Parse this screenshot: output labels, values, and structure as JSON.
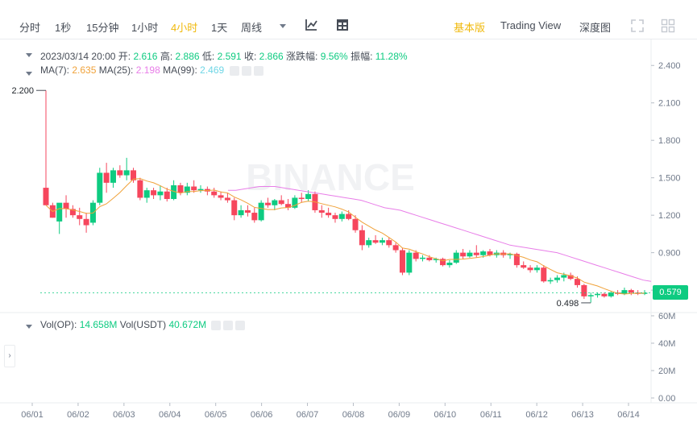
{
  "toolbar": {
    "timeframes": [
      "分时",
      "1秒",
      "15分钟",
      "1小时",
      "4小时",
      "1天",
      "周线"
    ],
    "active_timeframe": "4小时",
    "views": [
      "基本版",
      "Trading View",
      "深度图"
    ],
    "active_view": "基本版"
  },
  "candle_info": {
    "date": "2023/03/14 20:00",
    "open_label": "开:",
    "open": "2.616",
    "high_label": "高:",
    "high": "2.886",
    "low_label": "低:",
    "low": "2.591",
    "close_label": "收:",
    "close": "2.866",
    "change_label": "涨跌幅:",
    "change": "9.56%",
    "amplitude_label": "振幅:",
    "amplitude": "11.28%"
  },
  "ma_info": {
    "ma7_label": "MA(7):",
    "ma7": "2.635",
    "ma25_label": "MA(25):",
    "ma25": "2.198",
    "ma99_label": "MA(99):",
    "ma99": "2.469"
  },
  "vol_info": {
    "vol_op_label": "Vol(OP):",
    "vol_op": "14.658M",
    "vol_usdt_label": "Vol(USDT)",
    "vol_usdt": "40.672M"
  },
  "watermark": "BINANCE",
  "current_price": "0.579",
  "colors": {
    "up": "#0ecb81",
    "down": "#f6465d",
    "ma7": "#f0a23a",
    "ma25": "#e87de8",
    "accent": "#f0b90b"
  },
  "chart_data": {
    "type": "candlestick",
    "x_tick_labels": [
      "06/01",
      "06/02",
      "06/03",
      "06/04",
      "06/05",
      "06/06",
      "06/07",
      "06/08",
      "06/09",
      "06/10",
      "06/11",
      "06/12",
      "06/13",
      "06/14"
    ],
    "price_axis": {
      "ticks": [
        "2.400",
        "2.100",
        "1.800",
        "1.500",
        "1.200",
        "0.900",
        "0.600"
      ],
      "ylim": [
        0.42,
        2.55
      ]
    },
    "volume_axis": {
      "ticks": [
        "60M",
        "40M",
        "20M",
        "0.00"
      ],
      "ylim": [
        0,
        60
      ]
    },
    "annotations": {
      "high": "2.200",
      "low": "0.498"
    },
    "candles": [
      {
        "o": 1.42,
        "h": 2.2,
        "l": 1.36,
        "c": 1.28
      },
      {
        "o": 1.28,
        "h": 1.3,
        "l": 1.18,
        "c": 1.18
      },
      {
        "o": 1.15,
        "h": 1.28,
        "l": 1.05,
        "c": 1.3
      },
      {
        "o": 1.3,
        "h": 1.36,
        "l": 1.18,
        "c": 1.25
      },
      {
        "o": 1.25,
        "h": 1.28,
        "l": 1.18,
        "c": 1.2
      },
      {
        "o": 1.2,
        "h": 1.26,
        "l": 1.12,
        "c": 1.17
      },
      {
        "o": 1.17,
        "h": 1.22,
        "l": 1.06,
        "c": 1.12
      },
      {
        "o": 1.14,
        "h": 1.32,
        "l": 1.12,
        "c": 1.3
      },
      {
        "o": 1.3,
        "h": 1.58,
        "l": 1.28,
        "c": 1.54
      },
      {
        "o": 1.54,
        "h": 1.62,
        "l": 1.38,
        "c": 1.46
      },
      {
        "o": 1.46,
        "h": 1.58,
        "l": 1.42,
        "c": 1.56
      },
      {
        "o": 1.56,
        "h": 1.6,
        "l": 1.5,
        "c": 1.52
      },
      {
        "o": 1.52,
        "h": 1.66,
        "l": 1.48,
        "c": 1.56
      },
      {
        "o": 1.56,
        "h": 1.58,
        "l": 1.46,
        "c": 1.48
      },
      {
        "o": 1.48,
        "h": 1.5,
        "l": 1.32,
        "c": 1.34
      },
      {
        "o": 1.34,
        "h": 1.42,
        "l": 1.3,
        "c": 1.4
      },
      {
        "o": 1.4,
        "h": 1.42,
        "l": 1.33,
        "c": 1.36
      },
      {
        "o": 1.36,
        "h": 1.44,
        "l": 1.32,
        "c": 1.39
      },
      {
        "o": 1.39,
        "h": 1.42,
        "l": 1.31,
        "c": 1.33
      },
      {
        "o": 1.33,
        "h": 1.48,
        "l": 1.32,
        "c": 1.44
      },
      {
        "o": 1.44,
        "h": 1.46,
        "l": 1.36,
        "c": 1.38
      },
      {
        "o": 1.38,
        "h": 1.46,
        "l": 1.36,
        "c": 1.43
      },
      {
        "o": 1.43,
        "h": 1.48,
        "l": 1.38,
        "c": 1.4
      },
      {
        "o": 1.4,
        "h": 1.44,
        "l": 1.38,
        "c": 1.41
      },
      {
        "o": 1.41,
        "h": 1.43,
        "l": 1.36,
        "c": 1.39
      },
      {
        "o": 1.39,
        "h": 1.42,
        "l": 1.34,
        "c": 1.36
      },
      {
        "o": 1.36,
        "h": 1.39,
        "l": 1.32,
        "c": 1.34
      },
      {
        "o": 1.34,
        "h": 1.38,
        "l": 1.3,
        "c": 1.32
      },
      {
        "o": 1.32,
        "h": 1.34,
        "l": 1.16,
        "c": 1.2
      },
      {
        "o": 1.2,
        "h": 1.28,
        "l": 1.18,
        "c": 1.24
      },
      {
        "o": 1.24,
        "h": 1.28,
        "l": 1.19,
        "c": 1.22
      },
      {
        "o": 1.22,
        "h": 1.26,
        "l": 1.14,
        "c": 1.16
      },
      {
        "o": 1.16,
        "h": 1.32,
        "l": 1.15,
        "c": 1.3
      },
      {
        "o": 1.3,
        "h": 1.34,
        "l": 1.26,
        "c": 1.28
      },
      {
        "o": 1.28,
        "h": 1.33,
        "l": 1.24,
        "c": 1.32
      },
      {
        "o": 1.32,
        "h": 1.36,
        "l": 1.28,
        "c": 1.29
      },
      {
        "o": 1.29,
        "h": 1.33,
        "l": 1.24,
        "c": 1.26
      },
      {
        "o": 1.26,
        "h": 1.36,
        "l": 1.25,
        "c": 1.34
      },
      {
        "o": 1.34,
        "h": 1.38,
        "l": 1.3,
        "c": 1.33
      },
      {
        "o": 1.33,
        "h": 1.4,
        "l": 1.31,
        "c": 1.37
      },
      {
        "o": 1.37,
        "h": 1.39,
        "l": 1.22,
        "c": 1.24
      },
      {
        "o": 1.24,
        "h": 1.28,
        "l": 1.18,
        "c": 1.22
      },
      {
        "o": 1.22,
        "h": 1.26,
        "l": 1.18,
        "c": 1.2
      },
      {
        "o": 1.2,
        "h": 1.22,
        "l": 1.14,
        "c": 1.17
      },
      {
        "o": 1.17,
        "h": 1.23,
        "l": 1.15,
        "c": 1.21
      },
      {
        "o": 1.21,
        "h": 1.24,
        "l": 1.16,
        "c": 1.17
      },
      {
        "o": 1.17,
        "h": 1.2,
        "l": 1.06,
        "c": 1.08
      },
      {
        "o": 1.08,
        "h": 1.12,
        "l": 0.92,
        "c": 0.96
      },
      {
        "o": 0.96,
        "h": 1.02,
        "l": 0.94,
        "c": 1.0
      },
      {
        "o": 1.0,
        "h": 1.04,
        "l": 0.97,
        "c": 0.98
      },
      {
        "o": 0.98,
        "h": 1.02,
        "l": 0.96,
        "c": 1.0
      },
      {
        "o": 1.0,
        "h": 1.02,
        "l": 0.94,
        "c": 0.96
      },
      {
        "o": 0.96,
        "h": 0.98,
        "l": 0.9,
        "c": 0.92
      },
      {
        "o": 0.92,
        "h": 0.94,
        "l": 0.72,
        "c": 0.74
      },
      {
        "o": 0.74,
        "h": 0.92,
        "l": 0.72,
        "c": 0.9
      },
      {
        "o": 0.9,
        "h": 0.92,
        "l": 0.83,
        "c": 0.85
      },
      {
        "o": 0.85,
        "h": 0.88,
        "l": 0.83,
        "c": 0.86
      },
      {
        "o": 0.86,
        "h": 0.88,
        "l": 0.83,
        "c": 0.84
      },
      {
        "o": 0.84,
        "h": 0.86,
        "l": 0.82,
        "c": 0.85
      },
      {
        "o": 0.85,
        "h": 0.86,
        "l": 0.79,
        "c": 0.8
      },
      {
        "o": 0.8,
        "h": 0.84,
        "l": 0.78,
        "c": 0.82
      },
      {
        "o": 0.82,
        "h": 0.92,
        "l": 0.81,
        "c": 0.9
      },
      {
        "o": 0.9,
        "h": 0.93,
        "l": 0.85,
        "c": 0.87
      },
      {
        "o": 0.87,
        "h": 0.92,
        "l": 0.86,
        "c": 0.9
      },
      {
        "o": 0.9,
        "h": 0.96,
        "l": 0.86,
        "c": 0.88
      },
      {
        "o": 0.88,
        "h": 0.92,
        "l": 0.86,
        "c": 0.91
      },
      {
        "o": 0.91,
        "h": 0.93,
        "l": 0.87,
        "c": 0.88
      },
      {
        "o": 0.88,
        "h": 0.92,
        "l": 0.86,
        "c": 0.9
      },
      {
        "o": 0.9,
        "h": 0.92,
        "l": 0.86,
        "c": 0.88
      },
      {
        "o": 0.88,
        "h": 0.9,
        "l": 0.85,
        "c": 0.89
      },
      {
        "o": 0.89,
        "h": 0.9,
        "l": 0.78,
        "c": 0.8
      },
      {
        "o": 0.8,
        "h": 0.83,
        "l": 0.77,
        "c": 0.78
      },
      {
        "o": 0.78,
        "h": 0.8,
        "l": 0.74,
        "c": 0.76
      },
      {
        "o": 0.76,
        "h": 0.8,
        "l": 0.74,
        "c": 0.78
      },
      {
        "o": 0.78,
        "h": 0.8,
        "l": 0.66,
        "c": 0.67
      },
      {
        "o": 0.67,
        "h": 0.7,
        "l": 0.65,
        "c": 0.68
      },
      {
        "o": 0.68,
        "h": 0.72,
        "l": 0.66,
        "c": 0.7
      },
      {
        "o": 0.7,
        "h": 0.74,
        "l": 0.67,
        "c": 0.72
      },
      {
        "o": 0.72,
        "h": 0.74,
        "l": 0.68,
        "c": 0.69
      },
      {
        "o": 0.69,
        "h": 0.71,
        "l": 0.62,
        "c": 0.64
      },
      {
        "o": 0.64,
        "h": 0.65,
        "l": 0.53,
        "c": 0.55
      },
      {
        "o": 0.55,
        "h": 0.58,
        "l": 0.5,
        "c": 0.56
      },
      {
        "o": 0.56,
        "h": 0.58,
        "l": 0.54,
        "c": 0.57
      },
      {
        "o": 0.57,
        "h": 0.58,
        "l": 0.54,
        "c": 0.55
      },
      {
        "o": 0.55,
        "h": 0.59,
        "l": 0.54,
        "c": 0.58
      },
      {
        "o": 0.58,
        "h": 0.6,
        "l": 0.56,
        "c": 0.57
      },
      {
        "o": 0.57,
        "h": 0.62,
        "l": 0.56,
        "c": 0.6
      },
      {
        "o": 0.6,
        "h": 0.61,
        "l": 0.56,
        "c": 0.58
      },
      {
        "o": 0.58,
        "h": 0.6,
        "l": 0.56,
        "c": 0.57
      },
      {
        "o": 0.57,
        "h": 0.6,
        "l": 0.56,
        "c": 0.579
      }
    ],
    "ma25_values": [
      1.4,
      1.4,
      1.41,
      1.42,
      1.43,
      1.43,
      1.43,
      1.42,
      1.41,
      1.4,
      1.39,
      1.38,
      1.37,
      1.36,
      1.35,
      1.34,
      1.33,
      1.32,
      1.3,
      1.28,
      1.26,
      1.25,
      1.24,
      1.22,
      1.2,
      1.18,
      1.16,
      1.14,
      1.12,
      1.1,
      1.08,
      1.06,
      1.04,
      1.02,
      1.0,
      0.98,
      0.96,
      0.95,
      0.94,
      0.93,
      0.92,
      0.91,
      0.9,
      0.88,
      0.86,
      0.84,
      0.82,
      0.8,
      0.78,
      0.76,
      0.74,
      0.72,
      0.7,
      0.68,
      0.67
    ]
  }
}
